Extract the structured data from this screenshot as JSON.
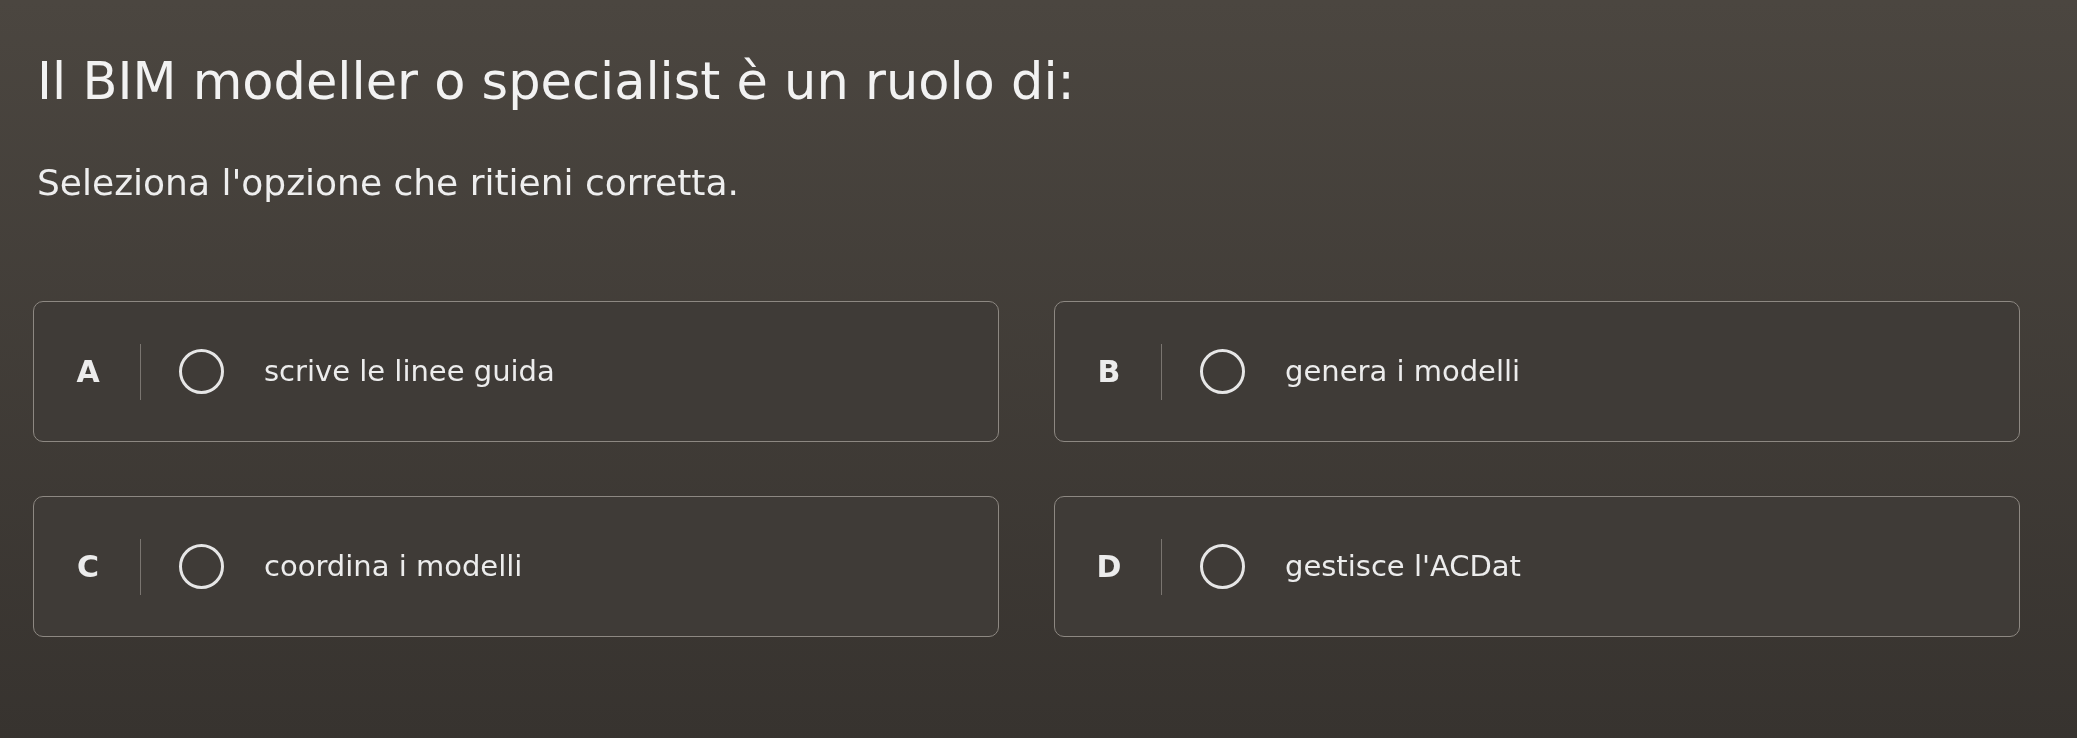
{
  "question": {
    "title": "Il BIM modeller o specialist è un ruolo di:",
    "instruction": "Seleziona l'opzione che ritieni corretta."
  },
  "options": [
    {
      "letter": "A",
      "text": "scrive le linee guida",
      "selected": false
    },
    {
      "letter": "B",
      "text": "genera i modelli",
      "selected": false
    },
    {
      "letter": "C",
      "text": "coordina i modelli",
      "selected": false
    },
    {
      "letter": "D",
      "text": "gestisce l'ACDat",
      "selected": false
    }
  ]
}
